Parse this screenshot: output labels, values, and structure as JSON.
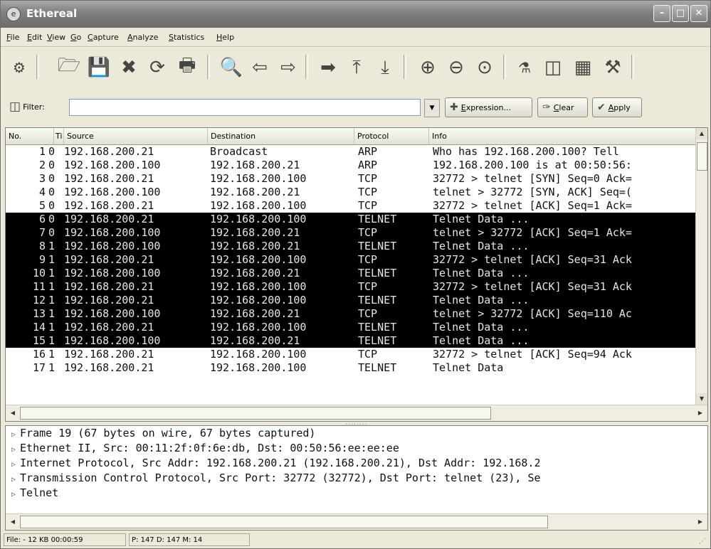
{
  "window": {
    "title": "Ethereal",
    "icon": "ethereal-app-icon",
    "controls": [
      "minimize",
      "maximize",
      "close"
    ]
  },
  "menu": [
    "File",
    "Edit",
    "View",
    "Go",
    "Capture",
    "Analyze",
    "Statistics",
    "Help"
  ],
  "toolbar": {
    "icons": [
      "interface-list-icon",
      "open-icon",
      "save-icon",
      "close-capture-icon",
      "reload-icon",
      "print-icon",
      "find-packet-icon",
      "go-back-icon",
      "go-forward-icon",
      "go-to-packet-icon",
      "go-to-first-icon",
      "go-to-last-icon",
      "zoom-in-icon",
      "zoom-out-icon",
      "zoom-normal-icon",
      "capture-filters-icon",
      "display-filters-icon",
      "coloring-rules-icon",
      "preferences-icon"
    ]
  },
  "filter": {
    "label": "Filter:",
    "value": "",
    "expression_label": "Expression...",
    "clear_label": "Clear",
    "apply_label": "Apply"
  },
  "packet_list": {
    "columns": [
      "No.",
      "Ti",
      "Source",
      "Destination",
      "Protocol",
      "Info"
    ],
    "rows": [
      {
        "no": "1",
        "time": "0",
        "source": "192.168.200.21",
        "destination": "Broadcast",
        "protocol": "ARP",
        "info": "Who has 192.168.200.100?  Tell",
        "style": "light"
      },
      {
        "no": "2",
        "time": "0",
        "source": "192.168.200.100",
        "destination": "192.168.200.21",
        "protocol": "ARP",
        "info": "192.168.200.100 is at 00:50:56:",
        "style": "light"
      },
      {
        "no": "3",
        "time": "0",
        "source": "192.168.200.21",
        "destination": "192.168.200.100",
        "protocol": "TCP",
        "info": "32772 > telnet [SYN] Seq=0 Ack=",
        "style": "light"
      },
      {
        "no": "4",
        "time": "0",
        "source": "192.168.200.100",
        "destination": "192.168.200.21",
        "protocol": "TCP",
        "info": "telnet > 32772 [SYN, ACK] Seq=(",
        "style": "light"
      },
      {
        "no": "5",
        "time": "0",
        "source": "192.168.200.21",
        "destination": "192.168.200.100",
        "protocol": "TCP",
        "info": "32772 > telnet [ACK] Seq=1 Ack=",
        "style": "light"
      },
      {
        "no": "6",
        "time": "0",
        "source": "192.168.200.21",
        "destination": "192.168.200.100",
        "protocol": "TELNET",
        "info": "Telnet Data ...",
        "style": "dark"
      },
      {
        "no": "7",
        "time": "0",
        "source": "192.168.200.100",
        "destination": "192.168.200.21",
        "protocol": "TCP",
        "info": "telnet > 32772 [ACK] Seq=1 Ack=",
        "style": "dark"
      },
      {
        "no": "8",
        "time": "1",
        "source": "192.168.200.100",
        "destination": "192.168.200.21",
        "protocol": "TELNET",
        "info": "Telnet Data ...",
        "style": "dark"
      },
      {
        "no": "9",
        "time": "1",
        "source": "192.168.200.21",
        "destination": "192.168.200.100",
        "protocol": "TCP",
        "info": "32772 > telnet [ACK] Seq=31 Ack",
        "style": "dark"
      },
      {
        "no": "10",
        "time": "1",
        "source": "192.168.200.100",
        "destination": "192.168.200.21",
        "protocol": "TELNET",
        "info": "Telnet Data ...",
        "style": "dark"
      },
      {
        "no": "11",
        "time": "1",
        "source": "192.168.200.21",
        "destination": "192.168.200.100",
        "protocol": "TCP",
        "info": "32772 > telnet [ACK] Seq=31 Ack",
        "style": "dark"
      },
      {
        "no": "12",
        "time": "1",
        "source": "192.168.200.21",
        "destination": "192.168.200.100",
        "protocol": "TELNET",
        "info": "Telnet Data ...",
        "style": "dark"
      },
      {
        "no": "13",
        "time": "1",
        "source": "192.168.200.100",
        "destination": "192.168.200.21",
        "protocol": "TCP",
        "info": "telnet > 32772 [ACK] Seq=110 Ac",
        "style": "dark"
      },
      {
        "no": "14",
        "time": "1",
        "source": "192.168.200.21",
        "destination": "192.168.200.100",
        "protocol": "TELNET",
        "info": "Telnet Data ...",
        "style": "dark"
      },
      {
        "no": "15",
        "time": "1",
        "source": "192.168.200.100",
        "destination": "192.168.200.21",
        "protocol": "TELNET",
        "info": "Telnet Data ...",
        "style": "dark"
      },
      {
        "no": "16",
        "time": "1",
        "source": "192.168.200.21",
        "destination": "192.168.200.100",
        "protocol": "TCP",
        "info": "32772 > telnet [ACK] Seq=94 Ack",
        "style": "light"
      },
      {
        "no": "17",
        "time": "1",
        "source": "192.168.200.21",
        "destination": "192.168.200.100",
        "protocol": "TELNET",
        "info": "Telnet Data",
        "style": "light"
      }
    ]
  },
  "details": {
    "lines": [
      "Frame 19 (67 bytes on wire, 67 bytes captured)",
      "Ethernet II, Src: 00:11:2f:0f:6e:db, Dst: 00:50:56:ee:ee:ee",
      "Internet Protocol, Src Addr: 192.168.200.21 (192.168.200.21), Dst Addr: 192.168.2",
      "Transmission Control Protocol, Src Port: 32772 (32772), Dst Port: telnet (23), Se",
      "Telnet"
    ]
  },
  "status": {
    "file": "File: - 12 KB 00:00:59",
    "packets": "P: 147 D: 147 M: 14"
  }
}
